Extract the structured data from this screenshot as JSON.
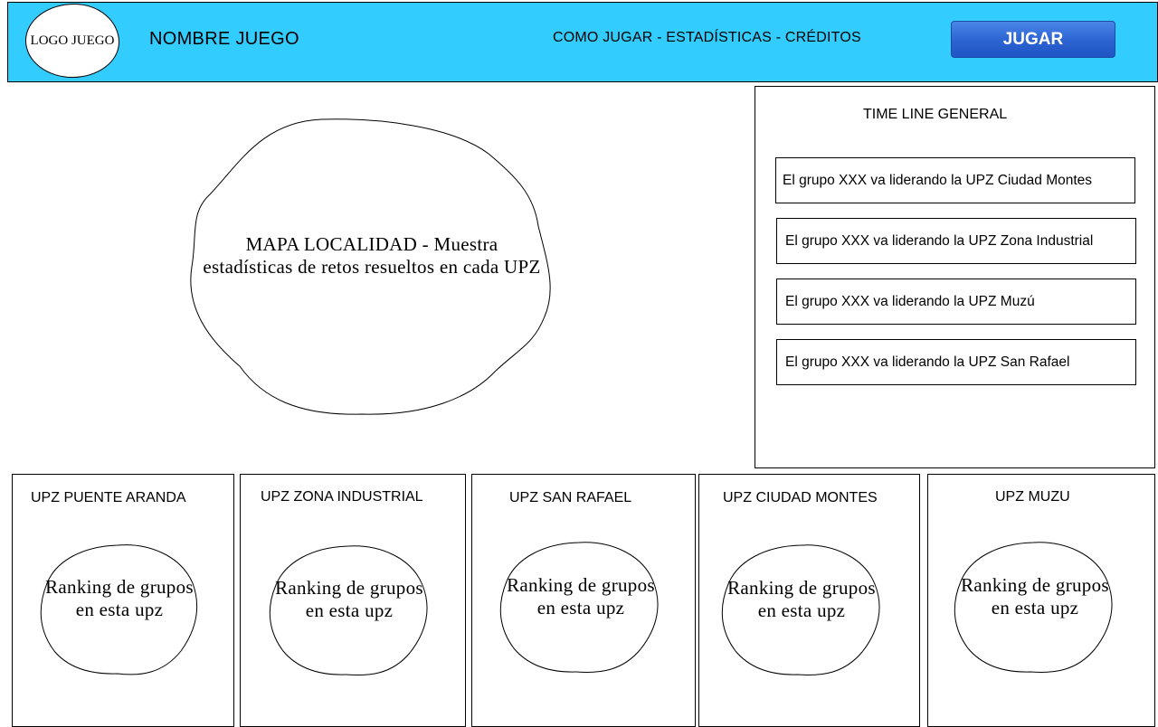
{
  "header": {
    "logo_text": "LOGO JUEGO",
    "game_name": "NOMBRE JUEGO",
    "nav_text": "COMO JUGAR - ESTADÍSTICAS - CRÉDITOS",
    "play_button": "JUGAR"
  },
  "map": {
    "text": "MAPA LOCALIDAD - Muestra estadísticas de retos resueltos en cada UPZ"
  },
  "timeline": {
    "title": "TIME LINE GENERAL",
    "items": [
      "El grupo XXX va liderando la UPZ Ciudad Montes",
      "El grupo XXX va liderando la UPZ Zona Industrial",
      "El grupo XXX va liderando la UPZ Muzú",
      "El grupo XXX va liderando la UPZ San Rafael"
    ]
  },
  "upz_panels": [
    {
      "title": "UPZ PUENTE ARANDA",
      "ranking": "Ranking de grupos en esta upz"
    },
    {
      "title": "UPZ ZONA INDUSTRIAL",
      "ranking": "Ranking de grupos en esta upz"
    },
    {
      "title": "UPZ SAN RAFAEL",
      "ranking": "Ranking de grupos en esta upz"
    },
    {
      "title": "UPZ CIUDAD MONTES",
      "ranking": "Ranking de grupos en esta upz"
    },
    {
      "title": "UPZ MUZU",
      "ranking": "Ranking de grupos en esta upz"
    }
  ],
  "colors": {
    "header_bg": "#33ccff",
    "play_button": "#2b63d1"
  }
}
